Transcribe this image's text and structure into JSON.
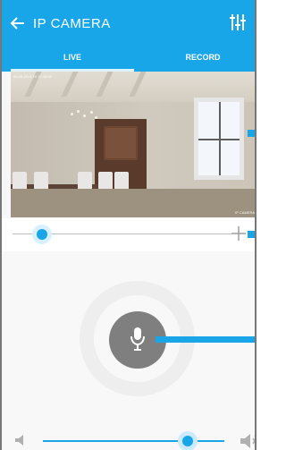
{
  "header": {
    "title": "IP CAMERA"
  },
  "tabs": [
    {
      "label": "LIVE"
    },
    {
      "label": "RECORD"
    }
  ],
  "video": {
    "timestamp": "09-26-2014 Fri 17:15:02",
    "camera_name": "IP CAMERA"
  },
  "icons": {
    "back": "arrow-left",
    "settings": "sliders",
    "ptz_plus": "plus",
    "mic": "microphone",
    "volume_low": "speaker-low",
    "volume_high": "speaker-high"
  },
  "controls": {
    "zoom_level": 0.12,
    "volume_level": 0.82
  },
  "colors": {
    "accent": "#19a6e8",
    "appbar": "#19a6e8",
    "mic_button": "#7f7f7f",
    "background": "#f8f8f8"
  }
}
